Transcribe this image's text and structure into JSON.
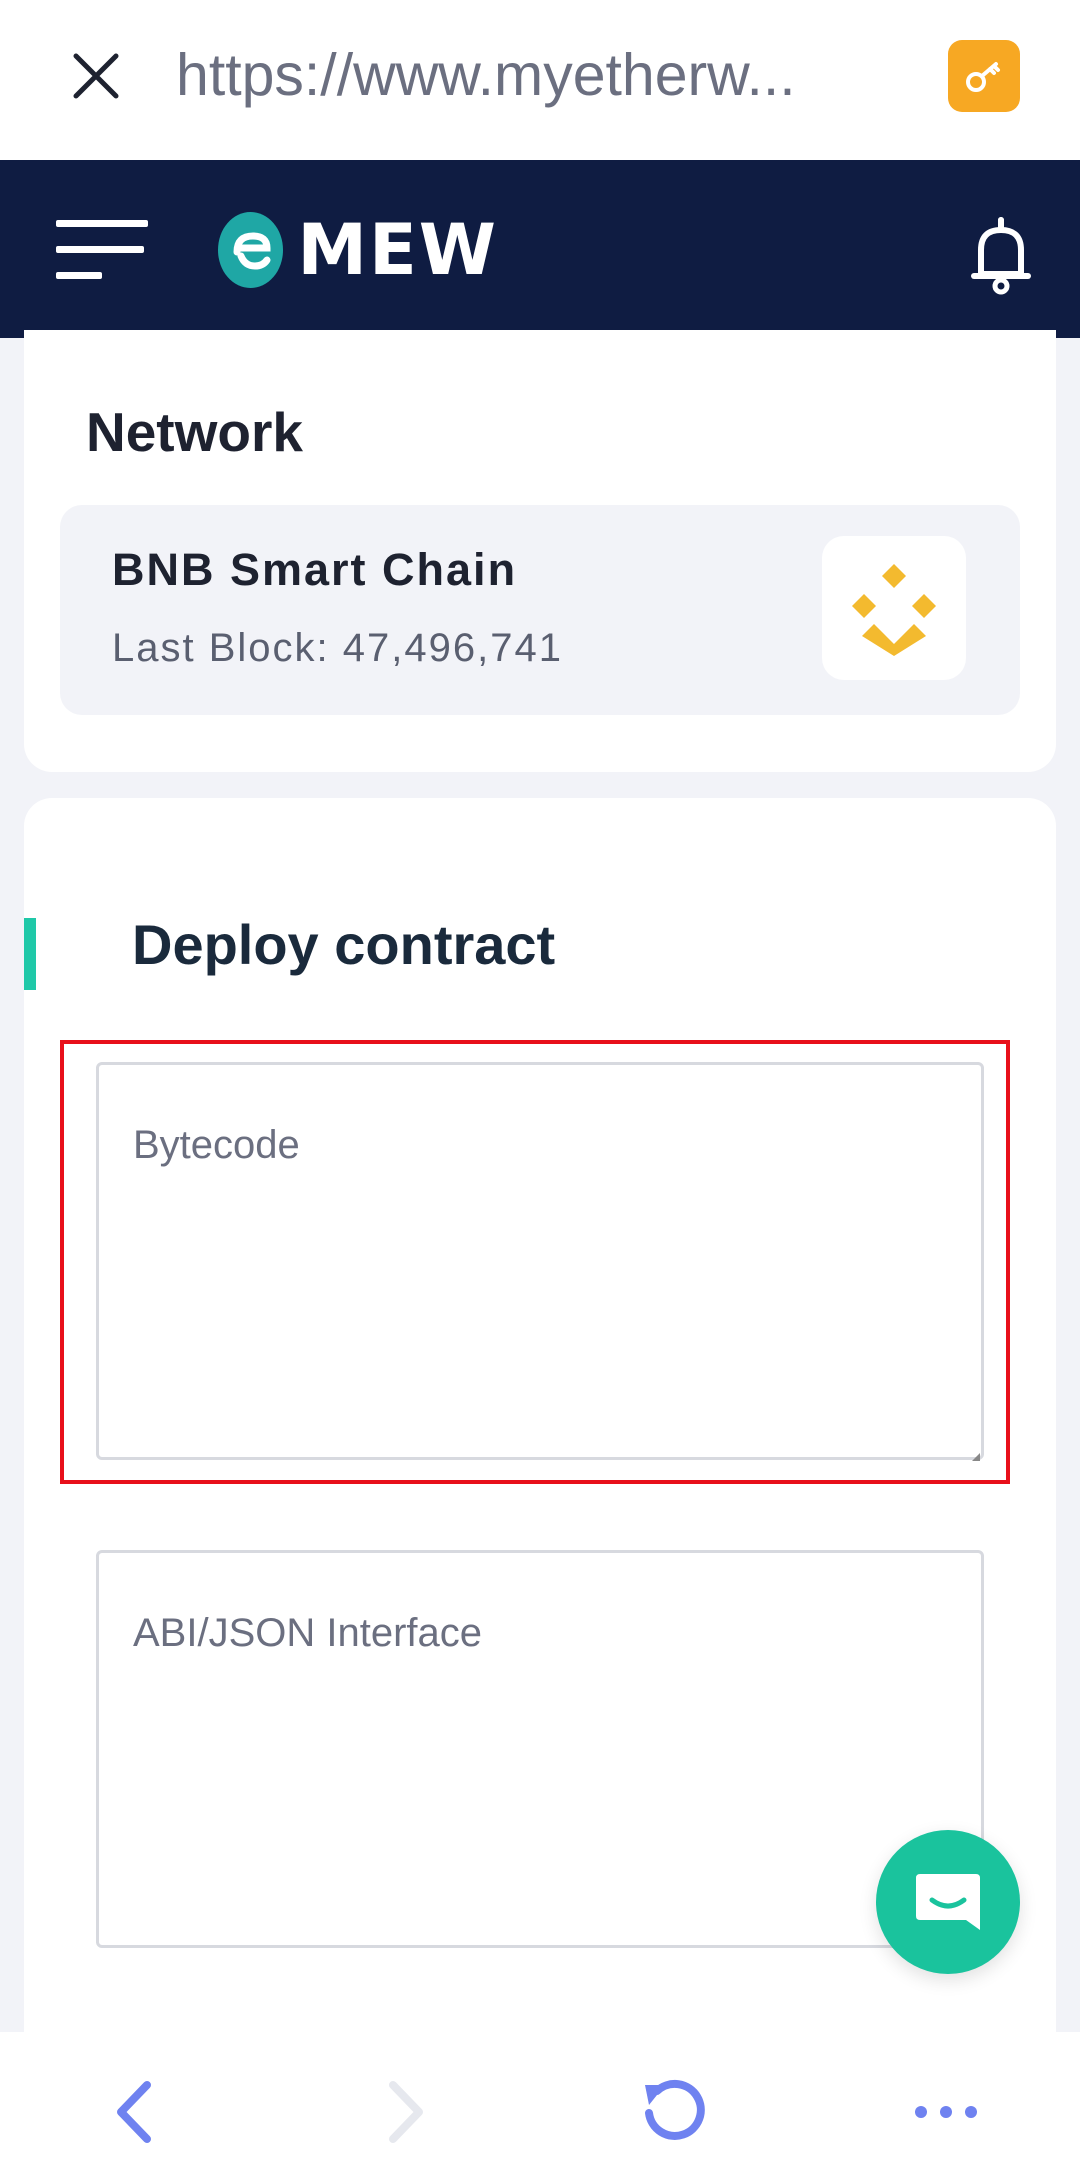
{
  "browser": {
    "url": "https://www.myetherw...",
    "close_icon": "close-icon",
    "key_icon": "key-icon",
    "accent_color": "#f7a823"
  },
  "header": {
    "brand": "MEW",
    "menu_icon": "hamburger-menu-icon",
    "logo_icon": "mew-logo-icon",
    "bell_icon": "bell-icon",
    "background": "#0f1c42"
  },
  "network": {
    "title": "Network",
    "name": "BNB Smart Chain",
    "last_block": "Last Block: 47,496,741",
    "icon": "bnb-icon",
    "icon_color": "#f3ba2f"
  },
  "deploy": {
    "title": "Deploy contract",
    "bytecode_placeholder": "Bytecode",
    "abi_placeholder": "ABI/JSON Interface",
    "accent_color": "#1fc8a8",
    "highlight_color": "#e8101a"
  },
  "chat": {
    "icon": "chat-icon",
    "color": "#1ac39d"
  },
  "bottom_nav": {
    "back_icon": "chevron-left-icon",
    "forward_icon": "chevron-right-icon",
    "reload_icon": "reload-icon",
    "more_icon": "more-dots-icon",
    "accent_color": "#6f82f0"
  }
}
